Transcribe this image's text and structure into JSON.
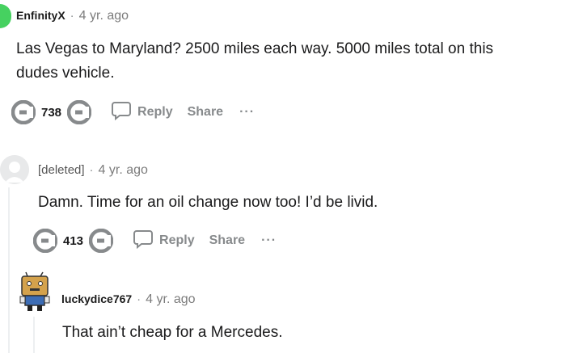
{
  "comments": [
    {
      "username": "EnfinityX",
      "separator": "·",
      "age": "4 yr. ago",
      "body_line1": "Las Vegas to Maryland? 2500 miles each way. 5000 miles total on this",
      "body_line2": "dudes vehicle.",
      "votes": "738",
      "reply_label": "Reply",
      "share_label": "Share",
      "more_label": "···"
    },
    {
      "username": "[deleted]",
      "separator": "·",
      "age": "4 yr. ago",
      "body": "Damn. Time for an oil change now too! I’d be livid.",
      "votes": "413",
      "reply_label": "Reply",
      "share_label": "Share",
      "more_label": "···"
    },
    {
      "username": "luckydice767",
      "separator": "·",
      "age": "4 yr. ago",
      "body": "That ain’t cheap for a Mercedes."
    }
  ],
  "icons": {
    "upvote": "upvote-icon",
    "downvote": "downvote-icon",
    "reply": "speech-bubble-icon"
  },
  "colors": {
    "avatar_green": "#46d160",
    "muted_text": "#878a8c"
  }
}
